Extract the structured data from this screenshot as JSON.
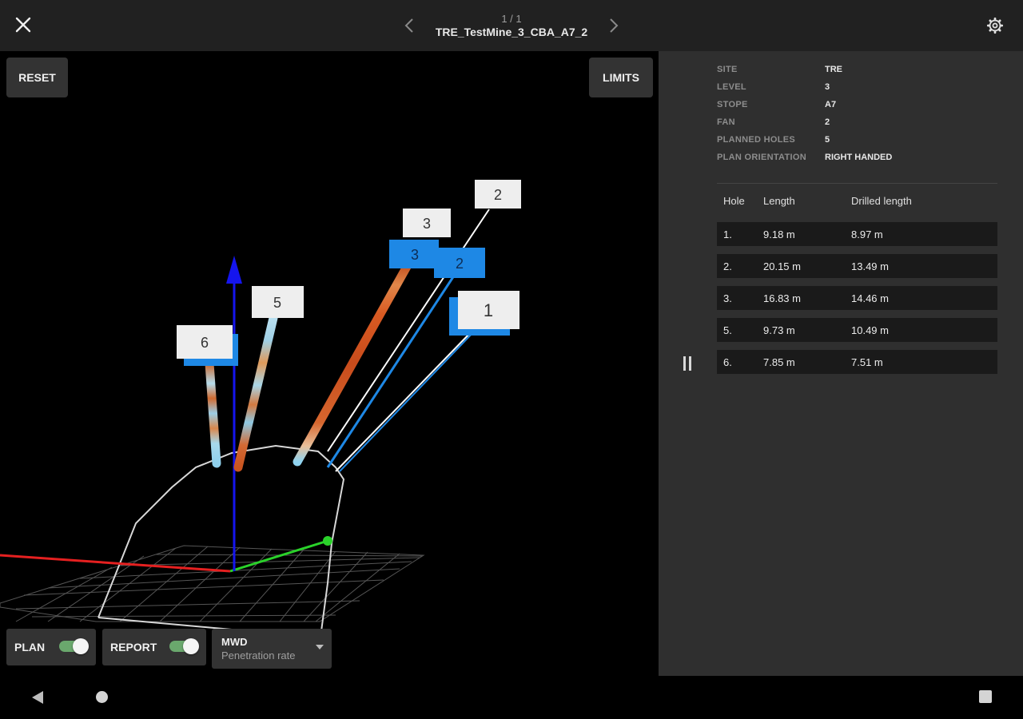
{
  "header": {
    "page_counter": "1 / 1",
    "title": "TRE_TestMine_3_CBA_A7_2",
    "close_icon": "close-icon",
    "prev_icon": "chevron-left-icon",
    "next_icon": "chevron-right-icon",
    "settings_icon": "gear-icon"
  },
  "viewport": {
    "reset_label": "RESET",
    "limits_label": "LIMITS",
    "hole_labels": [
      "2",
      "3",
      "5",
      "6",
      "1"
    ],
    "hole_labels_back": [
      "3",
      "2"
    ],
    "axis_colors": {
      "x": "#e52020",
      "y": "#2ad22a",
      "z": "#1515ee"
    },
    "plan_label": "PLAN",
    "plan_on": true,
    "report_label": "REPORT",
    "report_on": true,
    "mwd_label": "MWD",
    "mwd_value": "Penetration rate"
  },
  "info": [
    {
      "key": "SITE",
      "value": "TRE"
    },
    {
      "key": "LEVEL",
      "value": "3"
    },
    {
      "key": "STOPE",
      "value": "A7"
    },
    {
      "key": "FAN",
      "value": "2"
    },
    {
      "key": "PLANNED HOLES",
      "value": "5"
    },
    {
      "key": "PLAN ORIENTATION",
      "value": "RIGHT HANDED"
    }
  ],
  "table": {
    "headers": {
      "hole": "Hole",
      "length": "Length",
      "drilled": "Drilled length"
    },
    "rows": [
      {
        "hole": "1.",
        "length": "9.18 m",
        "drilled": "8.97 m"
      },
      {
        "hole": "2.",
        "length": "20.15 m",
        "drilled": "13.49 m"
      },
      {
        "hole": "3.",
        "length": "16.83 m",
        "drilled": "14.46 m"
      },
      {
        "hole": "5.",
        "length": "9.73 m",
        "drilled": "10.49 m"
      },
      {
        "hole": "6.",
        "length": "7.85 m",
        "drilled": "7.51 m"
      }
    ]
  },
  "system_nav": {
    "back_icon": "back-triangle-icon",
    "home_icon": "home-circle-icon",
    "recent_icon": "recents-square-icon"
  }
}
